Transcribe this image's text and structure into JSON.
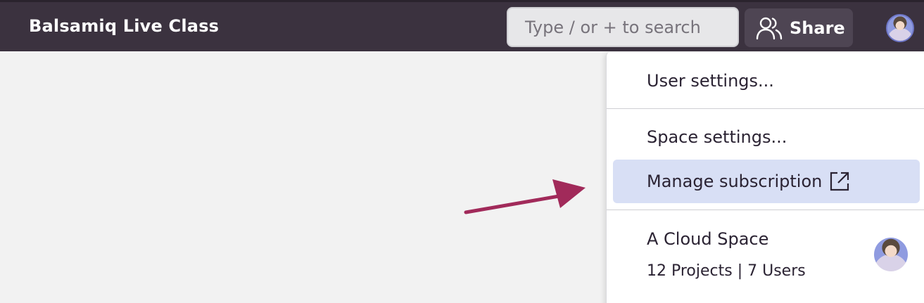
{
  "header": {
    "app_title": "Balsamiq Live Class",
    "search_placeholder": "Type / or + to search",
    "share_label": "Share"
  },
  "menu": {
    "user_settings": "User settings...",
    "space_settings": "Space settings...",
    "manage_subscription": "Manage subscription",
    "space": {
      "name": "A Cloud Space",
      "meta": "12 Projects | 7 Users"
    }
  },
  "colors": {
    "topbar": "#3b323f",
    "highlight": "#d8dff5",
    "arrow": "#a12a5a"
  }
}
